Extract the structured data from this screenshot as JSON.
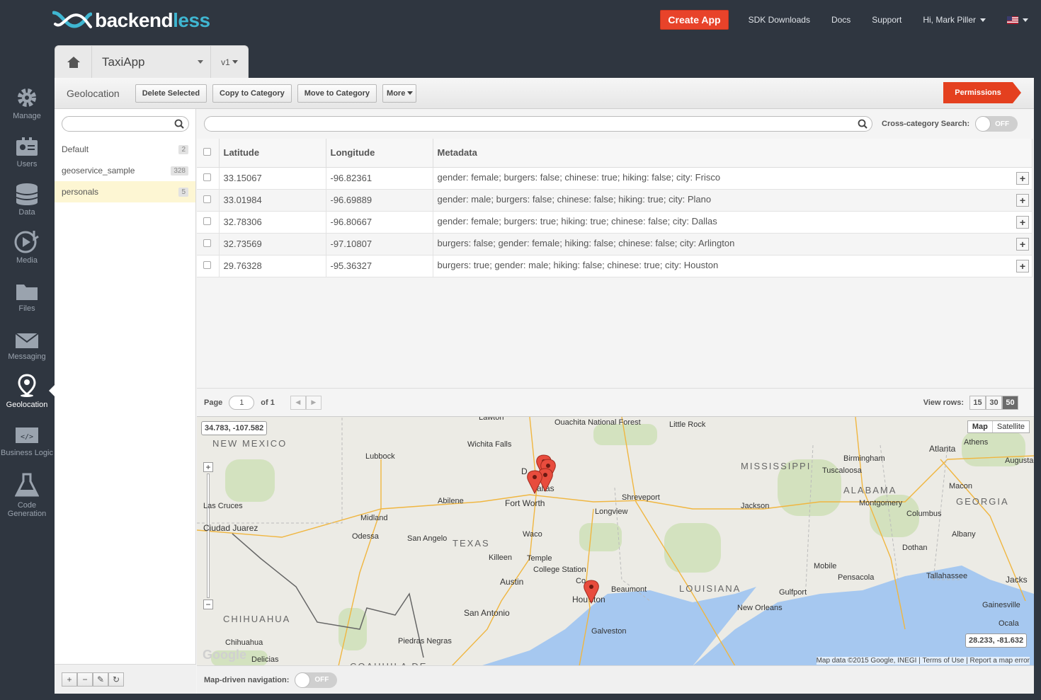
{
  "brand": {
    "name_part1": "backend",
    "name_part2": "less"
  },
  "top_nav": {
    "create_app": "Create App",
    "sdk": "SDK Downloads",
    "docs": "Docs",
    "support": "Support",
    "user": "Hi, Mark Piller"
  },
  "sidebar": [
    {
      "label": "Manage"
    },
    {
      "label": "Users"
    },
    {
      "label": "Data"
    },
    {
      "label": "Media"
    },
    {
      "label": "Files"
    },
    {
      "label": "Messaging"
    },
    {
      "label": "Geolocation"
    },
    {
      "label": "Business Logic"
    },
    {
      "label": "Code Generation"
    }
  ],
  "app": {
    "name": "TaxiApp",
    "version": "v1"
  },
  "toolbar": {
    "title": "Geolocation",
    "delete": "Delete Selected",
    "copy": "Copy to Category",
    "move": "Move to Category",
    "more": "More",
    "permissions": "Permissions"
  },
  "categories": [
    {
      "name": "Default",
      "count": "2"
    },
    {
      "name": "geoservice_sample",
      "count": "328"
    },
    {
      "name": "personals",
      "count": "5"
    }
  ],
  "search": {
    "cross_label": "Cross-category Search:",
    "toggle": "OFF"
  },
  "table": {
    "headers": [
      "Latitude",
      "Longitude",
      "Metadata"
    ],
    "rows": [
      {
        "lat": "33.15067",
        "lng": "-96.82361",
        "meta": "gender: female; burgers: false; chinese: true; hiking: false; city: Frisco"
      },
      {
        "lat": "33.01984",
        "lng": "-96.69889",
        "meta": "gender: male; burgers: false; chinese: false; hiking: true; city: Plano"
      },
      {
        "lat": "32.78306",
        "lng": "-96.80667",
        "meta": "gender: female; burgers: true; hiking: true; chinese: false; city: Dallas"
      },
      {
        "lat": "32.73569",
        "lng": "-97.10807",
        "meta": "burgers: false; gender: female; hiking: false; chinese: false; city: Arlington"
      },
      {
        "lat": "29.76328",
        "lng": "-95.36327",
        "meta": "burgers: true; gender: male; hiking: false; chinese: true; city: Houston"
      }
    ]
  },
  "pager": {
    "page_label": "Page",
    "page": "1",
    "of": "of 1",
    "view_rows": "View rows:",
    "sizes": [
      "15",
      "30",
      "50"
    ]
  },
  "map": {
    "nw_coord": "34.783, -107.582",
    "se_coord": "28.233, -81.632",
    "type_map": "Map",
    "type_sat": "Satellite",
    "attribution": "Map data ©2015 Google, INEGI",
    "terms": "Terms of Use",
    "report": "Report a map error",
    "labels": [
      {
        "t": "Lawton"
      },
      {
        "t": "Ouachita National Forest"
      },
      {
        "t": "Little Rock"
      },
      {
        "t": "NEW MEXICO"
      },
      {
        "t": "Wichita Falls"
      },
      {
        "t": "Lubbock"
      },
      {
        "t": "MISSISSIPPI"
      },
      {
        "t": "Birmingham"
      },
      {
        "t": "Tuscaloosa"
      },
      {
        "t": "Atlanta"
      },
      {
        "t": "Athens"
      },
      {
        "t": "Augusta"
      },
      {
        "t": "D"
      },
      {
        "t": "allas"
      },
      {
        "t": "Fort Worth"
      },
      {
        "t": "Abilene"
      },
      {
        "t": "Shreveport"
      },
      {
        "t": "Longview"
      },
      {
        "t": "ALABAMA"
      },
      {
        "t": "Montgomery"
      },
      {
        "t": "Macon"
      },
      {
        "t": "GEORGIA"
      },
      {
        "t": "Columbus"
      },
      {
        "t": "Las Cruces"
      },
      {
        "t": "Midland"
      },
      {
        "t": "Jackson"
      },
      {
        "t": "Ciudad Juarez"
      },
      {
        "t": "Odessa"
      },
      {
        "t": "San Angelo"
      },
      {
        "t": "TEXAS"
      },
      {
        "t": "Waco"
      },
      {
        "t": "Albany"
      },
      {
        "t": "Dothan"
      },
      {
        "t": "Killeen"
      },
      {
        "t": "Temple"
      },
      {
        "t": "College Station"
      },
      {
        "t": "Mobile"
      },
      {
        "t": "Pensacola"
      },
      {
        "t": "Tallahassee"
      },
      {
        "t": "Jacks"
      },
      {
        "t": "Austin"
      },
      {
        "t": "Co"
      },
      {
        "t": "Beaumont"
      },
      {
        "t": "LOUISIANA"
      },
      {
        "t": "Gulfport"
      },
      {
        "t": "Hou"
      },
      {
        "t": "ston"
      },
      {
        "t": "New Orleans"
      },
      {
        "t": "Gainesville"
      },
      {
        "t": "San Antonio"
      },
      {
        "t": "CHIHUAHUA"
      },
      {
        "t": "Galveston"
      },
      {
        "t": "Ocala"
      },
      {
        "t": "Chihuahua"
      },
      {
        "t": "Piedras Negras"
      },
      {
        "t": "Delicias"
      },
      {
        "t": "COAHUILA DE"
      }
    ],
    "logo": "Google"
  },
  "map_nav": {
    "label": "Map-driven navigation:",
    "toggle": "OFF"
  }
}
